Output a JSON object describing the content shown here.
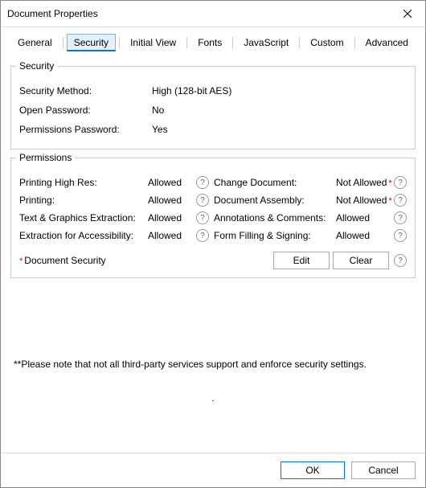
{
  "window": {
    "title": "Document Properties"
  },
  "tabs": [
    {
      "label": "General"
    },
    {
      "label": "Security"
    },
    {
      "label": "Initial View"
    },
    {
      "label": "Fonts"
    },
    {
      "label": "JavaScript"
    },
    {
      "label": "Custom"
    },
    {
      "label": "Advanced"
    }
  ],
  "active_tab_index": 1,
  "security": {
    "group_title": "Security",
    "method_label": "Security Method:",
    "method_value": "High (128-bit AES)",
    "open_pw_label": "Open Password:",
    "open_pw_value": "No",
    "perm_pw_label": "Permissions Password:",
    "perm_pw_value": "Yes"
  },
  "permissions": {
    "group_title": "Permissions",
    "rows": [
      {
        "left_label": "Printing High Res:",
        "left_value": "Allowed",
        "right_label": "Change Document:",
        "right_value": "Not Allowed",
        "right_restricted": true
      },
      {
        "left_label": "Printing:",
        "left_value": "Allowed",
        "right_label": "Document Assembly:",
        "right_value": "Not Allowed",
        "right_restricted": true
      },
      {
        "left_label": "Text & Graphics Extraction:",
        "left_value": "Allowed",
        "right_label": "Annotations & Comments:",
        "right_value": "Allowed",
        "right_restricted": false
      },
      {
        "left_label": "Extraction for Accessibility:",
        "left_value": "Allowed",
        "right_label": "Form Filling & Signing:",
        "right_value": "Allowed",
        "right_restricted": false
      }
    ]
  },
  "actions": {
    "doc_security_label": "Document Security",
    "edit_label": "Edit",
    "clear_label": "Clear"
  },
  "note_text": "**Please note that not all third-party services support and enforce security settings.",
  "buttons": {
    "ok": "OK",
    "cancel": "Cancel"
  },
  "glyphs": {
    "help": "?",
    "star": "*",
    "dot": "."
  }
}
